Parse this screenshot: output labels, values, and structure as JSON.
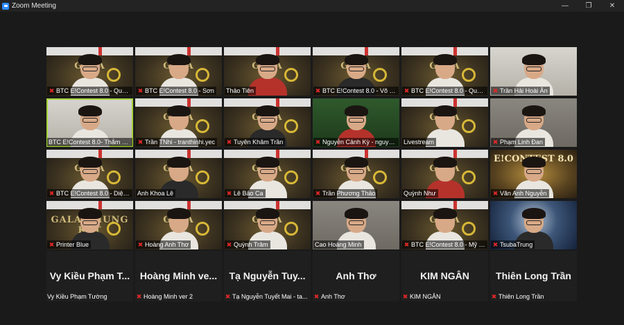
{
  "window": {
    "title": "Zoom Meeting",
    "controls": [
      "minimize",
      "maximize",
      "close"
    ]
  },
  "video_tiles": [
    {
      "name": "BTC E!Contest 8.0 - Quỳn...",
      "muted": true,
      "bg": "stage",
      "overlay": "GALA"
    },
    {
      "name": "BTC E!Contest 8.0 - Sơn",
      "muted": true,
      "bg": "stage",
      "overlay": "GALA"
    },
    {
      "name": "Thảo Tiên",
      "muted": false,
      "bg": "stage",
      "overlay": "GALA"
    },
    {
      "name": "BTC E!Contest 8.0 - Võ Ng...",
      "muted": true,
      "bg": "stage",
      "overlay": "GALA"
    },
    {
      "name": "BTC E!Contest 8.0 - Quốc ...",
      "muted": true,
      "bg": "stage",
      "overlay": "GALA"
    },
    {
      "name": "Trần Hải Hoài Ân",
      "muted": true,
      "bg": "lightroom",
      "overlay": ""
    },
    {
      "name": "BTC E!Contest 8.0- Thắm Qu...",
      "muted": false,
      "bg": "lightroom",
      "overlay": "",
      "speaking": true
    },
    {
      "name": "Trần TNhi - tranthinhi.yec",
      "muted": true,
      "bg": "stage",
      "overlay": "GALA"
    },
    {
      "name": "Tuyên Khâm Trần",
      "muted": true,
      "bg": "stage",
      "overlay": "GALA"
    },
    {
      "name": "Nguyễn Cảnh Kỳ - nguye...",
      "muted": true,
      "bg": "green",
      "overlay": ""
    },
    {
      "name": "Livestream",
      "muted": false,
      "bg": "stage",
      "overlay": "GALA"
    },
    {
      "name": "Phạm Linh Đan",
      "muted": true,
      "bg": "room",
      "overlay": ""
    },
    {
      "name": "BTC E!Contest 8.0 - Diệp ...",
      "muted": true,
      "bg": "stage",
      "overlay": "GALA"
    },
    {
      "name": "Anh Khoa Lê",
      "muted": false,
      "bg": "stage",
      "overlay": "GALA"
    },
    {
      "name": "Lê Bảo Ca",
      "muted": true,
      "bg": "stage",
      "overlay": "GALA"
    },
    {
      "name": "Trần Phương Thảo",
      "muted": true,
      "bg": "stage",
      "overlay": "GALA"
    },
    {
      "name": "Quỳnh Như",
      "muted": false,
      "bg": "stage",
      "overlay": "GALA"
    },
    {
      "name": "Văn Anh Nguyễn",
      "muted": true,
      "bg": "contest",
      "overlay": "E!CONTEST 8.0"
    },
    {
      "name": "Printer Blue",
      "muted": true,
      "bg": "stage",
      "overlay": "GALA CHUNG KẾT"
    },
    {
      "name": "Hoàng Anh Thơ",
      "muted": true,
      "bg": "stage",
      "overlay": "GALA"
    },
    {
      "name": "Quỳnh Trâm",
      "muted": true,
      "bg": "stage",
      "overlay": "GALA"
    },
    {
      "name": "Cao Hoàng Minh",
      "muted": false,
      "bg": "room",
      "overlay": ""
    },
    {
      "name": "BTC E!Contest 8.0 - Mỹ Hậu",
      "muted": true,
      "bg": "stage",
      "overlay": "GALA"
    },
    {
      "name": "TsubaTrung",
      "muted": true,
      "bg": "moon",
      "overlay": ""
    }
  ],
  "no_video_tiles": [
    {
      "display": "Vy Kiều Phạm T...",
      "name": "Vy Kiều Phạm Tường",
      "muted": false
    },
    {
      "display": "Hoàng Minh ve...",
      "name": "Hoàng Minh ver 2",
      "muted": true
    },
    {
      "display": "Tạ Nguyễn Tuy...",
      "name": "Tạ Nguyễn Tuyết Mai - ta...",
      "muted": true
    },
    {
      "display": "Anh Thơ",
      "name": "Anh Thơ",
      "muted": true
    },
    {
      "display": "KIM NGÂN",
      "name": "KIM NGÂN",
      "muted": true
    },
    {
      "display": "Thiên Long Trần",
      "name": "Thiên Long Trần",
      "muted": true
    }
  ]
}
